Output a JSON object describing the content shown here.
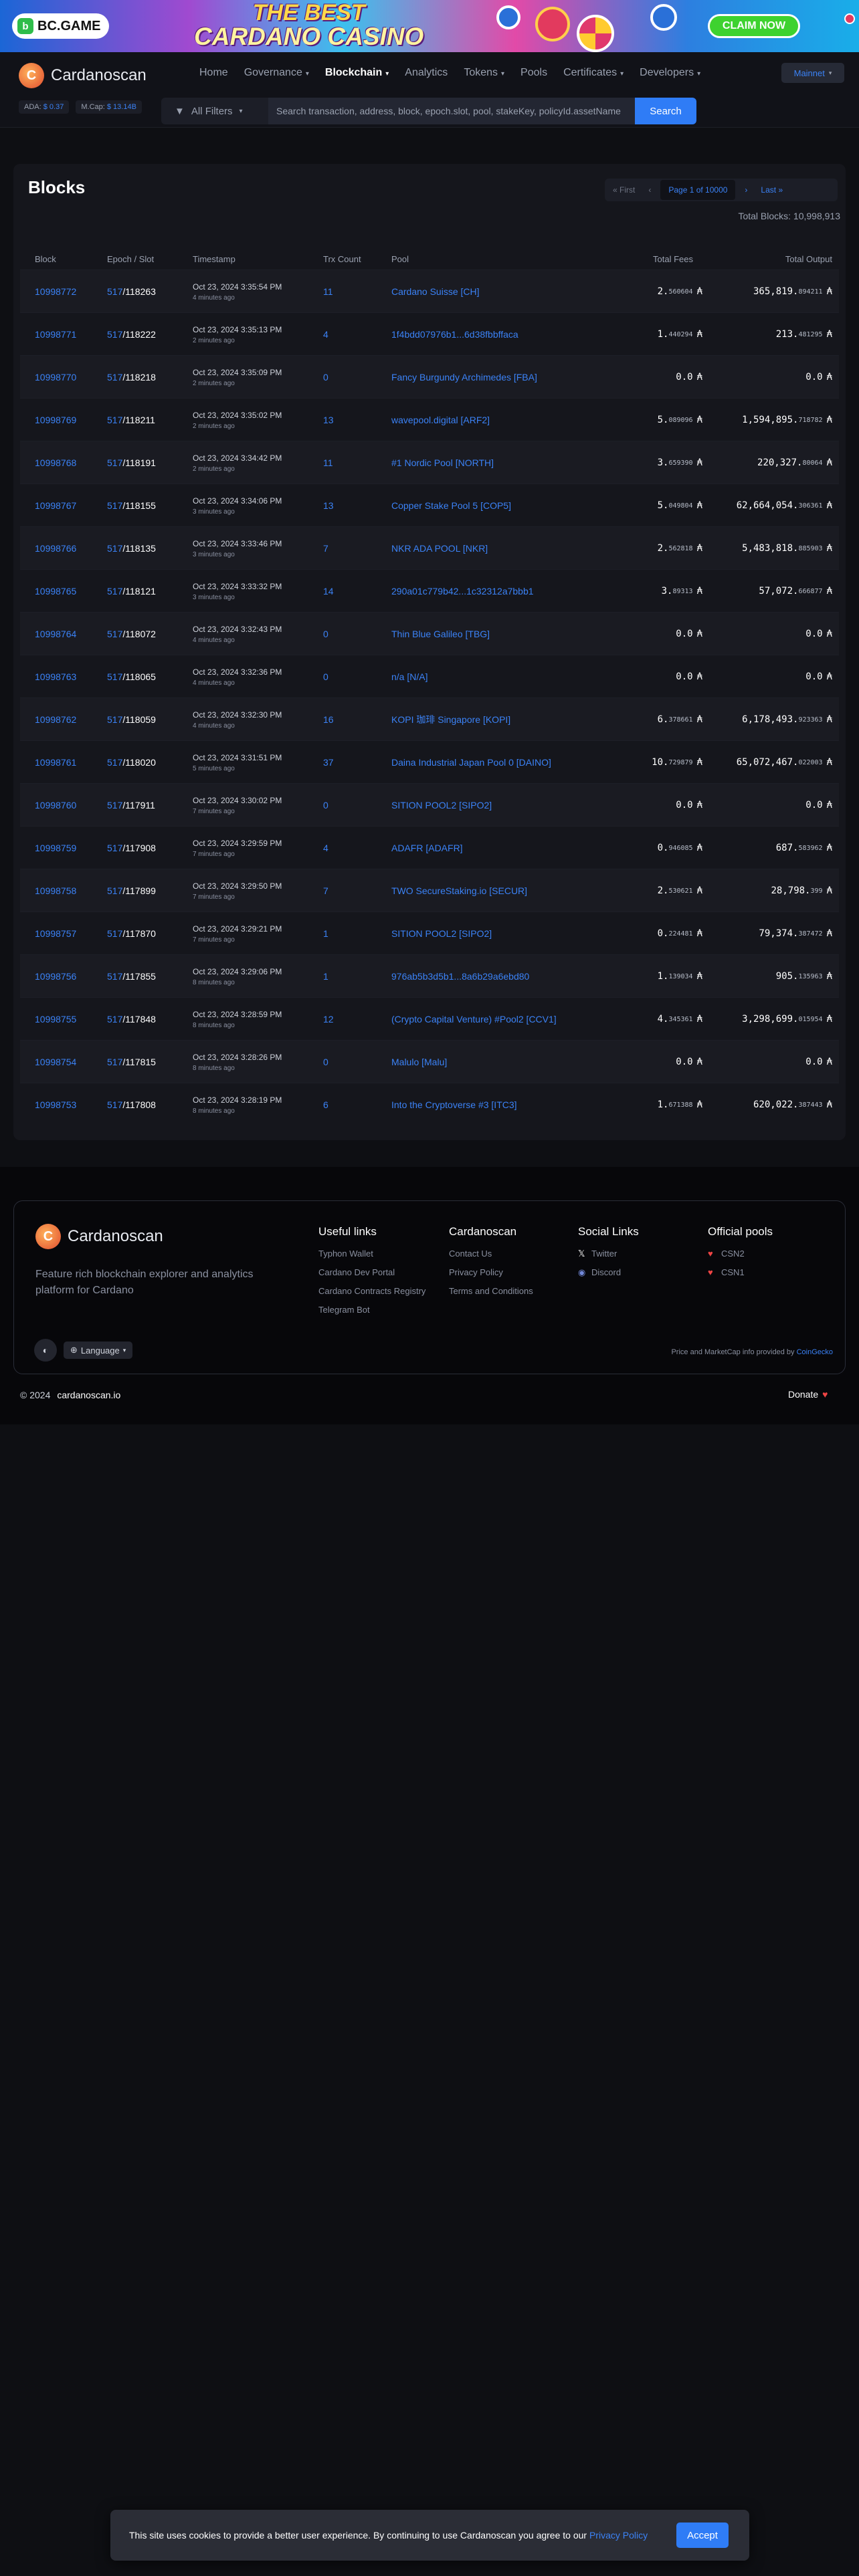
{
  "banner": {
    "brand": "BC.GAME",
    "line1": "THE BEST",
    "line2": "CARDANO CASINO",
    "cta": "CLAIM NOW"
  },
  "header": {
    "brand": "Cardanoscan",
    "ada_label": "ADA:",
    "ada_price": "$ 0.37",
    "mcap_label": "M.Cap:",
    "mcap_value": "$ 13.14B",
    "nav": {
      "home": "Home",
      "governance": "Governance",
      "blockchain": "Blockchain",
      "analytics": "Analytics",
      "tokens": "Tokens",
      "pools": "Pools",
      "certificates": "Certificates",
      "developers": "Developers"
    },
    "network": "Mainnet",
    "filter_label": "All Filters",
    "search_placeholder": "Search transaction, address, block, epoch.slot, pool, stakeKey, policyId.assetName",
    "search_button": "Search"
  },
  "blocks": {
    "title": "Blocks",
    "pager": {
      "first": "First",
      "page": "Page 1 of 10000",
      "last": "Last"
    },
    "total_label": "Total Blocks: 10,998,913",
    "columns": [
      "Block",
      "Epoch / Slot",
      "Timestamp",
      "Trx Count",
      "Pool",
      "Total Fees",
      "Total Output"
    ],
    "rows": [
      {
        "block": "10998772",
        "epoch": "517",
        "slot": "118263",
        "time": "Oct 23, 2024 3:35:54 PM",
        "ago": "4 minutes ago",
        "trx": "11",
        "pool": "Cardano Suisse [CH]",
        "fee_int": "2.",
        "fee_dec": "560604",
        "out_int": "365,819.",
        "out_dec": "894211"
      },
      {
        "block": "10998771",
        "epoch": "517",
        "slot": "118222",
        "time": "Oct 23, 2024 3:35:13 PM",
        "ago": "2 minutes ago",
        "trx": "4",
        "pool": "1f4bdd07976b1...6d38fbbffaca",
        "fee_int": "1.",
        "fee_dec": "440294",
        "out_int": "213.",
        "out_dec": "481295"
      },
      {
        "block": "10998770",
        "epoch": "517",
        "slot": "118218",
        "time": "Oct 23, 2024 3:35:09 PM",
        "ago": "2 minutes ago",
        "trx": "0",
        "pool": "Fancy Burgundy Archimedes [FBA]",
        "fee_int": "0.0",
        "fee_dec": "",
        "out_int": "0.0",
        "out_dec": ""
      },
      {
        "block": "10998769",
        "epoch": "517",
        "slot": "118211",
        "time": "Oct 23, 2024 3:35:02 PM",
        "ago": "2 minutes ago",
        "trx": "13",
        "pool": "wavepool.digital [ARF2]",
        "fee_int": "5.",
        "fee_dec": "089096",
        "out_int": "1,594,895.",
        "out_dec": "718782"
      },
      {
        "block": "10998768",
        "epoch": "517",
        "slot": "118191",
        "time": "Oct 23, 2024 3:34:42 PM",
        "ago": "2 minutes ago",
        "trx": "11",
        "pool": "#1 Nordic Pool [NORTH]",
        "fee_int": "3.",
        "fee_dec": "659390",
        "out_int": "220,327.",
        "out_dec": "80064"
      },
      {
        "block": "10998767",
        "epoch": "517",
        "slot": "118155",
        "time": "Oct 23, 2024 3:34:06 PM",
        "ago": "3 minutes ago",
        "trx": "13",
        "pool": "Copper Stake Pool 5 [COP5]",
        "fee_int": "5.",
        "fee_dec": "049804",
        "out_int": "62,664,054.",
        "out_dec": "306361"
      },
      {
        "block": "10998766",
        "epoch": "517",
        "slot": "118135",
        "time": "Oct 23, 2024 3:33:46 PM",
        "ago": "3 minutes ago",
        "trx": "7",
        "pool": "NKR ADA POOL [NKR]",
        "fee_int": "2.",
        "fee_dec": "562818",
        "out_int": "5,483,818.",
        "out_dec": "885903"
      },
      {
        "block": "10998765",
        "epoch": "517",
        "slot": "118121",
        "time": "Oct 23, 2024 3:33:32 PM",
        "ago": "3 minutes ago",
        "trx": "14",
        "pool": "290a01c779b42...1c32312a7bbb1",
        "fee_int": "3.",
        "fee_dec": "89313",
        "out_int": "57,072.",
        "out_dec": "666877"
      },
      {
        "block": "10998764",
        "epoch": "517",
        "slot": "118072",
        "time": "Oct 23, 2024 3:32:43 PM",
        "ago": "4 minutes ago",
        "trx": "0",
        "pool": "Thin Blue Galileo [TBG]",
        "fee_int": "0.0",
        "fee_dec": "",
        "out_int": "0.0",
        "out_dec": ""
      },
      {
        "block": "10998763",
        "epoch": "517",
        "slot": "118065",
        "time": "Oct 23, 2024 3:32:36 PM",
        "ago": "4 minutes ago",
        "trx": "0",
        "pool": "n/a [N/A]",
        "fee_int": "0.0",
        "fee_dec": "",
        "out_int": "0.0",
        "out_dec": ""
      },
      {
        "block": "10998762",
        "epoch": "517",
        "slot": "118059",
        "time": "Oct 23, 2024 3:32:30 PM",
        "ago": "4 minutes ago",
        "trx": "16",
        "pool": "KOPI 珈琲 Singapore [KOPI]",
        "fee_int": "6.",
        "fee_dec": "378661",
        "out_int": "6,178,493.",
        "out_dec": "923363"
      },
      {
        "block": "10998761",
        "epoch": "517",
        "slot": "118020",
        "time": "Oct 23, 2024 3:31:51 PM",
        "ago": "5 minutes ago",
        "trx": "37",
        "pool": "Daina Industrial Japan Pool 0 [DAINO]",
        "fee_int": "10.",
        "fee_dec": "729879",
        "out_int": "65,072,467.",
        "out_dec": "022003"
      },
      {
        "block": "10998760",
        "epoch": "517",
        "slot": "117911",
        "time": "Oct 23, 2024 3:30:02 PM",
        "ago": "7 minutes ago",
        "trx": "0",
        "pool": "SITION POOL2 [SIPO2]",
        "fee_int": "0.0",
        "fee_dec": "",
        "out_int": "0.0",
        "out_dec": ""
      },
      {
        "block": "10998759",
        "epoch": "517",
        "slot": "117908",
        "time": "Oct 23, 2024 3:29:59 PM",
        "ago": "7 minutes ago",
        "trx": "4",
        "pool": "ADAFR [ADAFR]",
        "fee_int": "0.",
        "fee_dec": "946085",
        "out_int": "687.",
        "out_dec": "583962"
      },
      {
        "block": "10998758",
        "epoch": "517",
        "slot": "117899",
        "time": "Oct 23, 2024 3:29:50 PM",
        "ago": "7 minutes ago",
        "trx": "7",
        "pool": "TWO SecureStaking.io [SECUR]",
        "fee_int": "2.",
        "fee_dec": "530621",
        "out_int": "28,798.",
        "out_dec": "399"
      },
      {
        "block": "10998757",
        "epoch": "517",
        "slot": "117870",
        "time": "Oct 23, 2024 3:29:21 PM",
        "ago": "7 minutes ago",
        "trx": "1",
        "pool": "SITION POOL2 [SIPO2]",
        "fee_int": "0.",
        "fee_dec": "224481",
        "out_int": "79,374.",
        "out_dec": "387472"
      },
      {
        "block": "10998756",
        "epoch": "517",
        "slot": "117855",
        "time": "Oct 23, 2024 3:29:06 PM",
        "ago": "8 minutes ago",
        "trx": "1",
        "pool": "976ab5b3d5b1...8a6b29a6ebd80",
        "fee_int": "1.",
        "fee_dec": "139034",
        "out_int": "905.",
        "out_dec": "135963"
      },
      {
        "block": "10998755",
        "epoch": "517",
        "slot": "117848",
        "time": "Oct 23, 2024 3:28:59 PM",
        "ago": "8 minutes ago",
        "trx": "12",
        "pool": "(Crypto Capital Venture) #Pool2 [CCV1]",
        "fee_int": "4.",
        "fee_dec": "345361",
        "out_int": "3,298,699.",
        "out_dec": "015954"
      },
      {
        "block": "10998754",
        "epoch": "517",
        "slot": "117815",
        "time": "Oct 23, 2024 3:28:26 PM",
        "ago": "8 minutes ago",
        "trx": "0",
        "pool": "Malulo [Malu]",
        "fee_int": "0.0",
        "fee_dec": "",
        "out_int": "0.0",
        "out_dec": ""
      },
      {
        "block": "10998753",
        "epoch": "517",
        "slot": "117808",
        "time": "Oct 23, 2024 3:28:19 PM",
        "ago": "8 minutes ago",
        "trx": "6",
        "pool": "Into the Cryptoverse #3 [ITC3]",
        "fee_int": "1.",
        "fee_dec": "671388",
        "out_int": "620,022.",
        "out_dec": "387443"
      }
    ]
  },
  "footer": {
    "brand": "Cardanoscan",
    "description": "Feature rich blockchain explorer and analytics platform for Cardano",
    "useful_links": {
      "title": "Useful links",
      "items": [
        "Typhon Wallet",
        "Cardano Dev Portal",
        "Cardano Contracts Registry",
        "Telegram Bot"
      ]
    },
    "cardanoscan": {
      "title": "Cardanoscan",
      "items": [
        "Contact Us",
        "Privacy Policy",
        "Terms and Conditions"
      ]
    },
    "social": {
      "title": "Social Links",
      "items": [
        "Twitter",
        "Discord"
      ]
    },
    "pools": {
      "title": "Official pools",
      "items": [
        "CSN2",
        "CSN1"
      ]
    },
    "language": "Language",
    "price_note": "Price and MarketCap info provided by",
    "price_provider": "CoinGecko",
    "copyright": "© 2024",
    "domain": "cardanoscan.io",
    "donate": "Donate"
  },
  "cookie": {
    "text": "This site uses cookies to provide a better user experience. By continuing to use Cardanoscan you agree to our",
    "link": "Privacy Policy",
    "accept": "Accept"
  },
  "colors": {
    "accent": "#2f7cf6",
    "link": "#3b82f6",
    "background": "#0e0f13",
    "card": "#15161c"
  }
}
